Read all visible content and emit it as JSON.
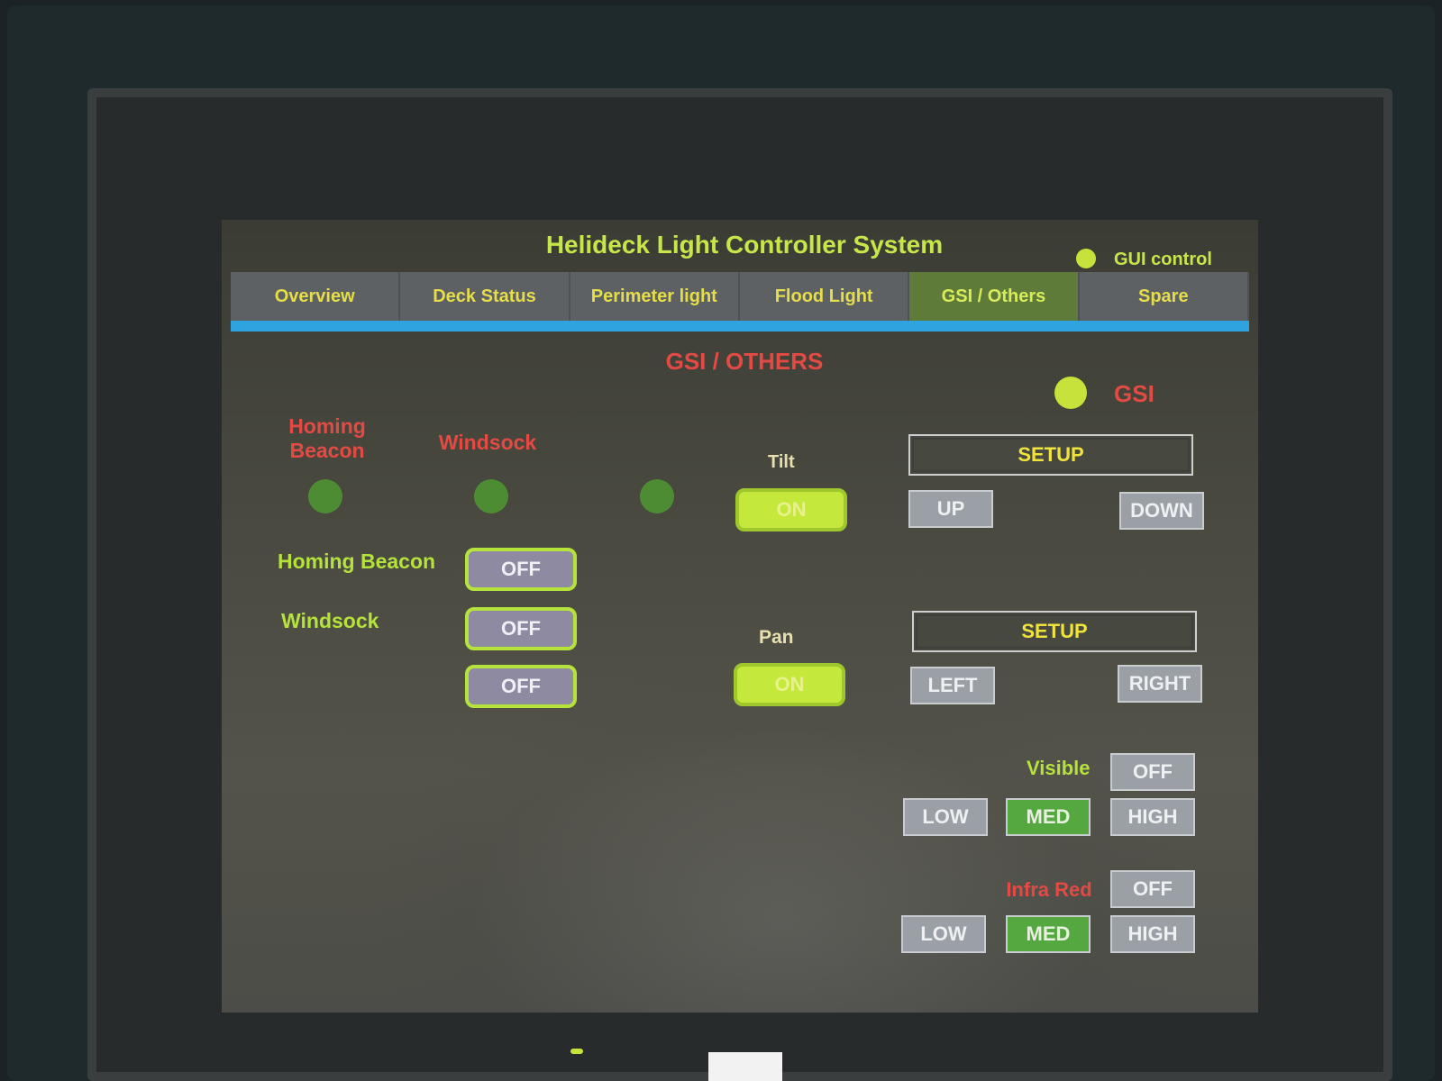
{
  "app": {
    "title": "Helideck Light Controller System",
    "gui_control_label": "GUI control"
  },
  "tabs": [
    {
      "label": "Overview"
    },
    {
      "label": "Deck Status"
    },
    {
      "label": "Perimeter light"
    },
    {
      "label": "Flood Light"
    },
    {
      "label": "GSI / Others",
      "active": true
    },
    {
      "label": "Spare"
    }
  ],
  "page": {
    "heading": "GSI / OTHERS",
    "gsi_label": "GSI"
  },
  "status": {
    "homing_beacon_label": "Homing\nBeacon",
    "windsock_label": "Windsock",
    "tilt_label": "Tilt",
    "pan_label": "Pan"
  },
  "controls": {
    "homing_beacon": {
      "label": "Homing Beacon",
      "state": "OFF"
    },
    "windsock": {
      "label": "Windsock",
      "state": "OFF"
    },
    "extra": {
      "state": "OFF"
    },
    "tilt_state": "ON",
    "pan_state": "ON"
  },
  "tilt_setup": {
    "label": "SETUP",
    "up": "UP",
    "down": "DOWN"
  },
  "pan_setup": {
    "label": "SETUP",
    "left": "LEFT",
    "right": "RIGHT"
  },
  "visible": {
    "label": "Visible",
    "off": "OFF",
    "low": "LOW",
    "med": "MED",
    "high": "HIGH",
    "selected": "MED"
  },
  "infra_red": {
    "label": "Infra Red",
    "off": "OFF",
    "low": "LOW",
    "med": "MED",
    "high": "HIGH",
    "selected": "MED"
  },
  "colors": {
    "accent_green": "#b5e33c",
    "alarm_red": "#e34a44",
    "tab_underline": "#2fa3e0",
    "selected_button": "#55a840"
  }
}
